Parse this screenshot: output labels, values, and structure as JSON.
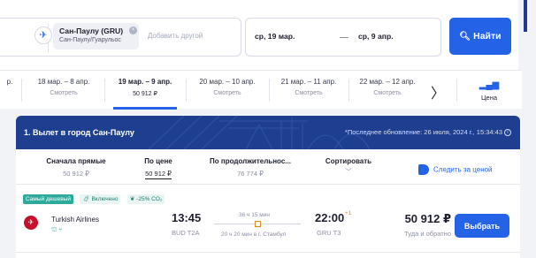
{
  "search": {
    "origin_code_name": "Сан-Паулу (GRU)",
    "origin_sub": "Сан-Паулу/Гуарульос",
    "add_other_placeholder": "Добавить другой",
    "date_from": "ср, 19 мар.",
    "date_to": "ср, 9 апр.",
    "find_label": "Найти"
  },
  "date_strip": {
    "cells": [
      {
        "range": "р.",
        "sub": ""
      },
      {
        "range": "18 мар. – 8 апр.",
        "sub": "Смотреть"
      },
      {
        "range": "19 мар. – 9 апр.",
        "sub": "50 912 ₽"
      },
      {
        "range": "20 мар. – 10 апр.",
        "sub": "Смотреть"
      },
      {
        "range": "21 мар. – 11 апр.",
        "sub": "Смотреть"
      },
      {
        "range": "22 мар. – 12 апр.",
        "sub": "Смотреть"
      }
    ],
    "active_index": 2,
    "price_chart_label": "Цена"
  },
  "results": {
    "banner_title": "1. Вылет в город Сан-Паулу",
    "banner_update": "*Последнее обновление: 26 июля, 2024 г., 15:34:43",
    "sort": [
      {
        "title": "Сначала прямые",
        "value": "50 912 ₽"
      },
      {
        "title": "По цене",
        "value": "50 912 ₽"
      },
      {
        "title": "По продолжительнос...",
        "value": "76 774 ₽"
      },
      {
        "title": "Сортировать",
        "value": ""
      }
    ],
    "active_sort": 1,
    "track_label": "Следить за ценой",
    "flight": {
      "badge_cheapest": "Самый дешевый",
      "badge_included": "Включено",
      "badge_co2": "-25% CO₂",
      "airline": "Turkish Airlines",
      "dep_time": "13:45",
      "dep_airport": "BUD T2A",
      "duration": "36 ч 15 мин",
      "stop_info": "20 ч 20 мин в г. Стамбул",
      "arr_time": "22:00",
      "arr_day_offset": "+1",
      "arr_airport": "GRU T3",
      "price": "50 912 ₽",
      "price_sub": "Туда и обратно",
      "choose_label": "Выбрать"
    }
  },
  "colors": {
    "accent": "#2563e6",
    "banner": "#1e3f8f",
    "badge_green": "#2eaa9c",
    "airline_red": "#c8102e"
  }
}
